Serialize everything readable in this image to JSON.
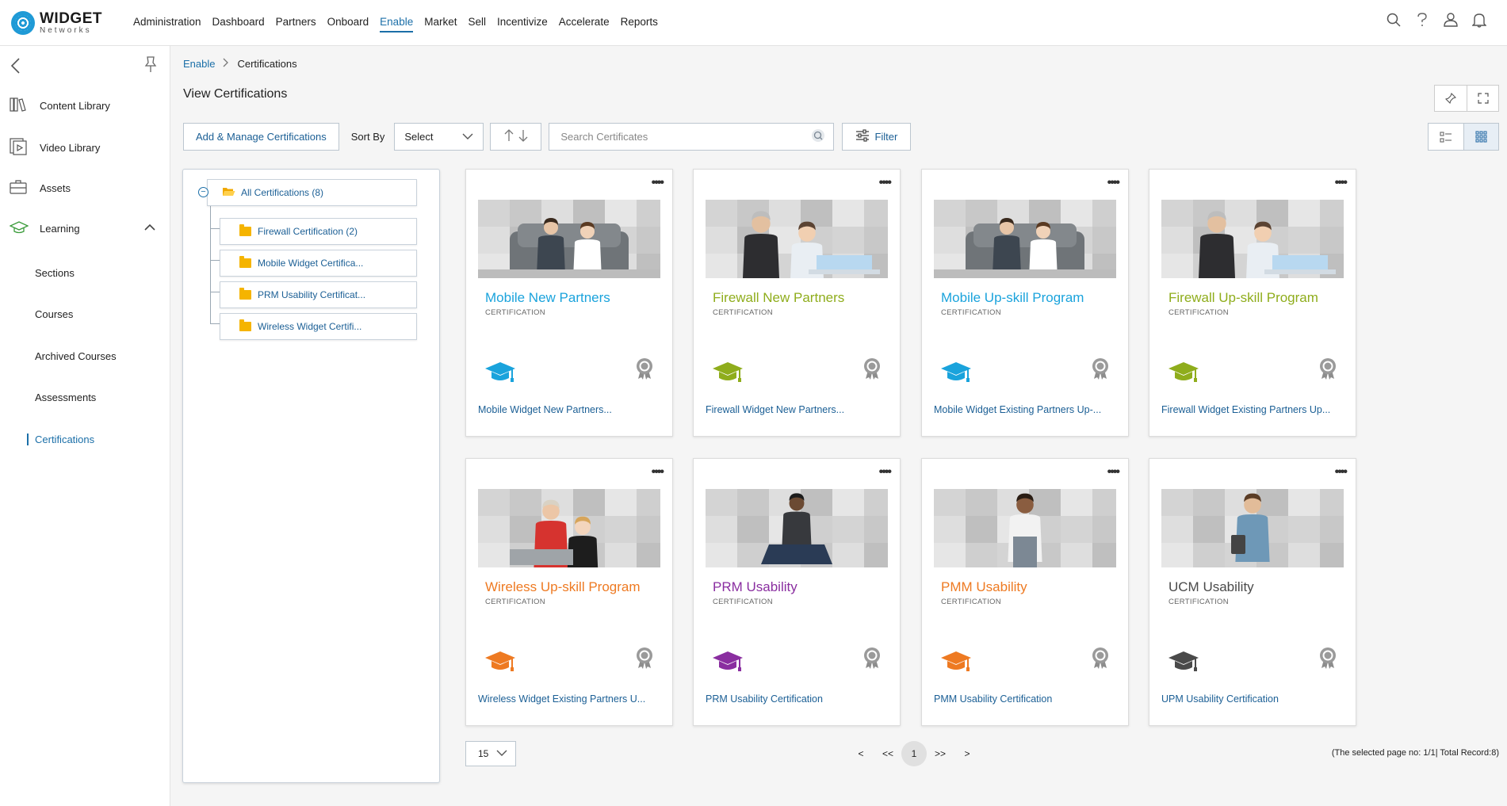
{
  "brand": {
    "name": "WIDGET",
    "sub": "Networks"
  },
  "nav": [
    "Administration",
    "Dashboard",
    "Partners",
    "Onboard",
    "Enable",
    "Market",
    "Sell",
    "Incentivize",
    "Accelerate",
    "Reports"
  ],
  "nav_active": "Enable",
  "sidebar": {
    "items": [
      "Content Library",
      "Video Library",
      "Assets",
      "Learning"
    ],
    "learning_sub": [
      "Sections",
      "Courses",
      "Archived Courses",
      "Assessments",
      "Certifications"
    ],
    "active_sub": "Certifications"
  },
  "breadcrumb": {
    "parent": "Enable",
    "current": "Certifications"
  },
  "page_title": "View Certifications",
  "toolbar": {
    "add_label": "Add & Manage Certifications",
    "sort_label": "Sort By",
    "sort_value": "Select",
    "search_placeholder": "Search Certificates",
    "filter_label": "Filter"
  },
  "tree": {
    "root": "All Certifications (8)",
    "children": [
      "Firewall Certification (2)",
      "Mobile Widget Certifica...",
      "PRM Usability Certificat...",
      "Wireless Widget Certifi..."
    ]
  },
  "cards": [
    {
      "title": "Mobile New Partners",
      "subtitle": "CERTIFICATION",
      "name": "Mobile Widget New Partners...",
      "color": "#1aa3dc",
      "image": "couple-sofa"
    },
    {
      "title": "Firewall New Partners",
      "subtitle": "CERTIFICATION",
      "name": "Firewall Widget New Partners...",
      "color": "#8fad1c",
      "image": "two-men-laptop"
    },
    {
      "title": "Mobile Up-skill Program",
      "subtitle": "CERTIFICATION",
      "name": "Mobile Widget Existing Partners Up-...",
      "color": "#1aa3dc",
      "image": "couple-sofa"
    },
    {
      "title": "Firewall Up-skill Program",
      "subtitle": "CERTIFICATION",
      "name": "Firewall Widget Existing Partners Up...",
      "color": "#8fad1c",
      "image": "two-men-laptop"
    },
    {
      "title": "Wireless Up-skill Program",
      "subtitle": "CERTIFICATION",
      "name": "Wireless Widget Existing Partners U...",
      "color": "#ee7a22",
      "image": "man-woman-laptop"
    },
    {
      "title": "PRM Usability",
      "subtitle": "CERTIFICATION",
      "name": "PRM Usability Certification",
      "color": "#8a2ea0",
      "image": "man-phone"
    },
    {
      "title": "PMM Usability",
      "subtitle": "CERTIFICATION",
      "name": "PMM Usability Certification",
      "color": "#ee7a22",
      "image": "woman-standing"
    },
    {
      "title": "UCM Usability",
      "subtitle": "CERTIFICATION",
      "name": "UPM Usability Certification",
      "color": "#4a4a4a",
      "image": "man-tablet"
    }
  ],
  "pagination": {
    "per_page": "15",
    "controls": [
      "<",
      "<<",
      "1",
      ">>",
      ">"
    ],
    "current": "1",
    "info": "(The selected page no: 1/1| Total Record:8)"
  }
}
